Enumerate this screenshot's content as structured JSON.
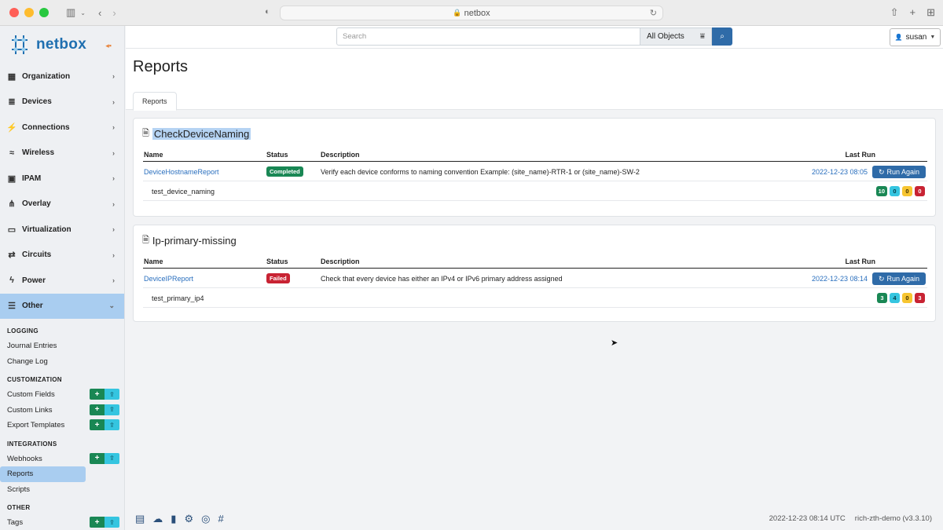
{
  "browser": {
    "url": "netbox",
    "lights": [
      "#ff5f57",
      "#febc2e",
      "#28c840"
    ]
  },
  "brand": {
    "name": "netbox",
    "color": "#1f6fb0"
  },
  "sidebar": {
    "nav": [
      {
        "label": "Organization",
        "icon": "building-icon",
        "glyph": "▦"
      },
      {
        "label": "Devices",
        "icon": "server-icon",
        "glyph": "≣"
      },
      {
        "label": "Connections",
        "icon": "plug-icon",
        "glyph": "⚡"
      },
      {
        "label": "Wireless",
        "icon": "wifi-icon",
        "glyph": "≈"
      },
      {
        "label": "IPAM",
        "icon": "counter-icon",
        "glyph": "▣"
      },
      {
        "label": "Overlay",
        "icon": "graph-icon",
        "glyph": "⋔"
      },
      {
        "label": "Virtualization",
        "icon": "monitor-icon",
        "glyph": "▭"
      },
      {
        "label": "Circuits",
        "icon": "transit-icon",
        "glyph": "⇄"
      },
      {
        "label": "Power",
        "icon": "bolt-icon",
        "glyph": "ϟ"
      },
      {
        "label": "Other",
        "icon": "menu-icon",
        "glyph": "☰"
      }
    ],
    "sections": [
      {
        "label": "LOGGING",
        "items": [
          {
            "label": "Journal Entries",
            "buttons": false
          },
          {
            "label": "Change Log",
            "buttons": false
          }
        ]
      },
      {
        "label": "CUSTOMIZATION",
        "items": [
          {
            "label": "Custom Fields",
            "buttons": true
          },
          {
            "label": "Custom Links",
            "buttons": true
          },
          {
            "label": "Export Templates",
            "buttons": true
          }
        ]
      },
      {
        "label": "INTEGRATIONS",
        "items": [
          {
            "label": "Webhooks",
            "buttons": true
          },
          {
            "label": "Reports",
            "buttons": false,
            "active": true
          },
          {
            "label": "Scripts",
            "buttons": false
          }
        ]
      },
      {
        "label": "OTHER",
        "items": [
          {
            "label": "Tags",
            "buttons": true
          }
        ]
      }
    ],
    "add_glyph": "+",
    "import_glyph": "⇪"
  },
  "header": {
    "search_placeholder": "Search",
    "object_filter": "All Objects",
    "user": "susan"
  },
  "page": {
    "title": "Reports",
    "tab": "Reports"
  },
  "table_headers": {
    "name": "Name",
    "status": "Status",
    "description": "Description",
    "last_run": "Last Run"
  },
  "reports": [
    {
      "module": "CheckDeviceNaming",
      "highlighted": true,
      "name": "DeviceHostnameReport",
      "status": "Completed",
      "status_color": "#198754",
      "description": "Verify each device conforms to naming convention Example: (site_name)-RTR-1 or (site_name)-SW-2",
      "last_run": "2022-12-23 08:05",
      "button": "Run Again",
      "test": "test_device_naming",
      "counts": [
        {
          "value": "10",
          "bg": "#198754",
          "fg": "#ffffff"
        },
        {
          "value": "0",
          "bg": "#35c5e0",
          "fg": "#053844"
        },
        {
          "value": "0",
          "bg": "#f7c531",
          "fg": "#3a2c00"
        },
        {
          "value": "0",
          "bg": "#c82333",
          "fg": "#ffffff"
        }
      ]
    },
    {
      "module": "Ip-primary-missing",
      "highlighted": false,
      "name": "DeviceIPReport",
      "status": "Failed",
      "status_color": "#c82333",
      "description": "Check that every device has either an IPv4 or IPv6 primary address assigned",
      "last_run": "2022-12-23 08:14",
      "button": "Run Again",
      "test": "test_primary_ip4",
      "counts": [
        {
          "value": "3",
          "bg": "#198754",
          "fg": "#ffffff"
        },
        {
          "value": "4",
          "bg": "#35c5e0",
          "fg": "#053844"
        },
        {
          "value": "0",
          "bg": "#f7c531",
          "fg": "#3a2c00"
        },
        {
          "value": "3",
          "bg": "#c82333",
          "fg": "#ffffff"
        }
      ]
    }
  ],
  "footer": {
    "timestamp": "2022-12-23 08:14 UTC",
    "instance": "rich-zth-demo (v3.3.10)",
    "icons": [
      "docs-icon",
      "cloud-icon",
      "book-icon",
      "gear-icon",
      "github-icon",
      "slack-icon"
    ]
  }
}
